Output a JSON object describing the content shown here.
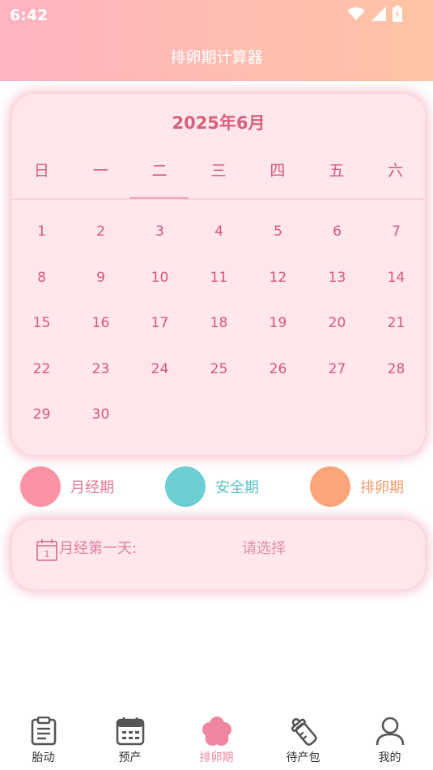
{
  "status_bar": {
    "time": "6:42"
  },
  "header": {
    "title": "排卵期计算器"
  },
  "calendar": {
    "month_title": "2025年6月",
    "weekdays": [
      "日",
      "一",
      "二",
      "三",
      "四",
      "五",
      "六"
    ],
    "selected_weekday": "二",
    "start_offset": 0,
    "days": [
      "1",
      "2",
      "3",
      "4",
      "5",
      "6",
      "7",
      "8",
      "9",
      "10",
      "11",
      "12",
      "13",
      "14",
      "15",
      "16",
      "17",
      "18",
      "19",
      "20",
      "21",
      "22",
      "23",
      "24",
      "25",
      "26",
      "27",
      "28",
      "29",
      "30"
    ]
  },
  "legend": [
    {
      "label": "月经期",
      "color": "#fb93a4",
      "text_color": "#e17a95"
    },
    {
      "label": "安全期",
      "color": "#6dcfd3",
      "text_color": "#5ec4c8"
    },
    {
      "label": "排卵期",
      "color": "#fba679",
      "text_color": "#f59c6c"
    }
  ],
  "selector": {
    "label": "月经第一天:",
    "value": "请选择"
  },
  "nav": {
    "items": [
      {
        "label": "胎动",
        "icon": "clipboard-icon"
      },
      {
        "label": "预产",
        "icon": "calendar-icon"
      },
      {
        "label": "排卵期",
        "icon": "flower-icon",
        "active": true
      },
      {
        "label": "待产包",
        "icon": "baby-bottle-icon"
      },
      {
        "label": "我的",
        "icon": "person-icon"
      }
    ],
    "active_color": "#ef86a1",
    "inactive_color": "#333333"
  }
}
